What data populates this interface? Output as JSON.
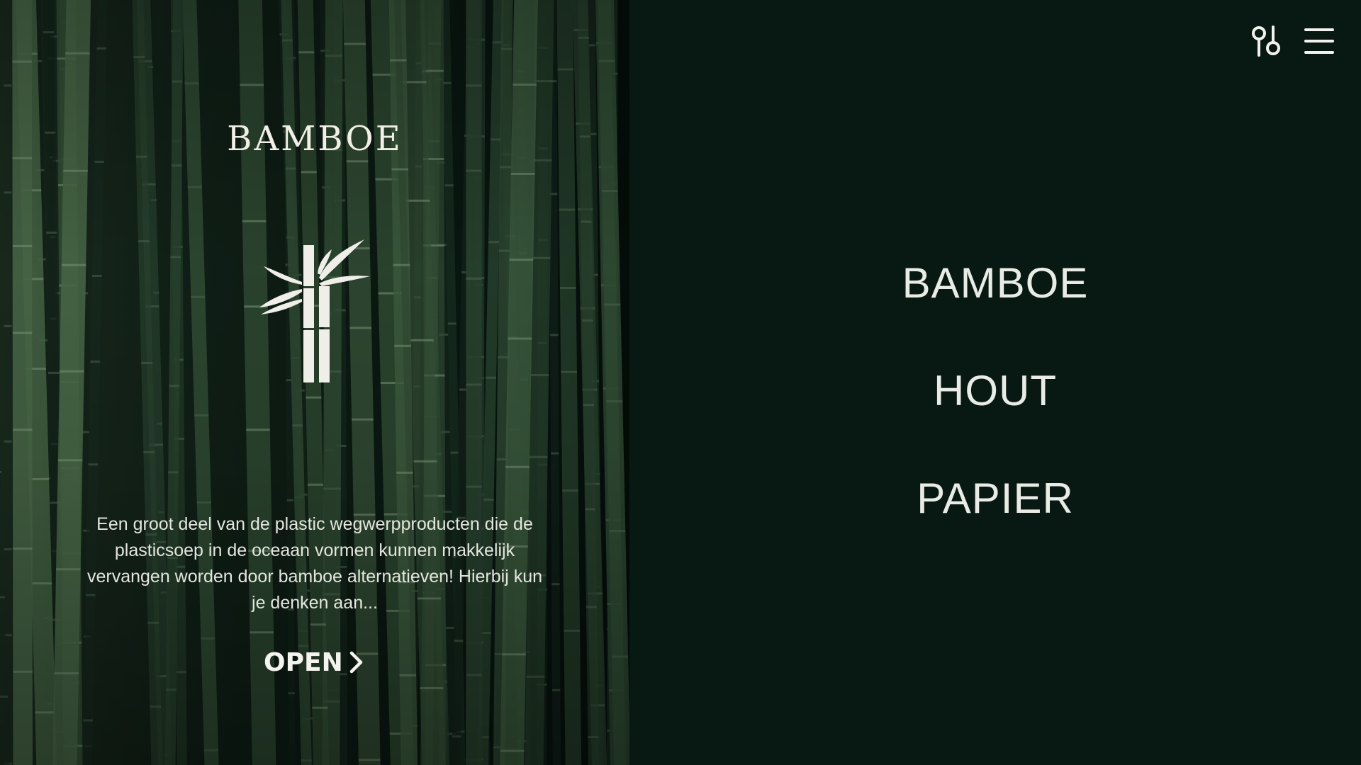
{
  "brand": {
    "title": "BAMBOE",
    "logo_icon": "bamboo-icon"
  },
  "intro": {
    "text": "Een groot deel van de plastic wegwerpproducten die de plasticsoep in de oceaan vormen kunnen makkelijk vervangen worden door bamboe alternatieven! Hierbij kun je denken aan..."
  },
  "actions": {
    "open_label": "OPEN",
    "open_icon": "chevron-right-icon"
  },
  "header": {
    "filter_icon": "sliders-icon",
    "menu_icon": "hamburger-menu-icon"
  },
  "categories": [
    {
      "label": "BAMBOE"
    },
    {
      "label": "HOUT"
    },
    {
      "label": "PAPIER"
    }
  ],
  "colors": {
    "panel_background": "#081813",
    "text_light": "#e9ece6",
    "bamboo_green": "#3d5a3b"
  }
}
